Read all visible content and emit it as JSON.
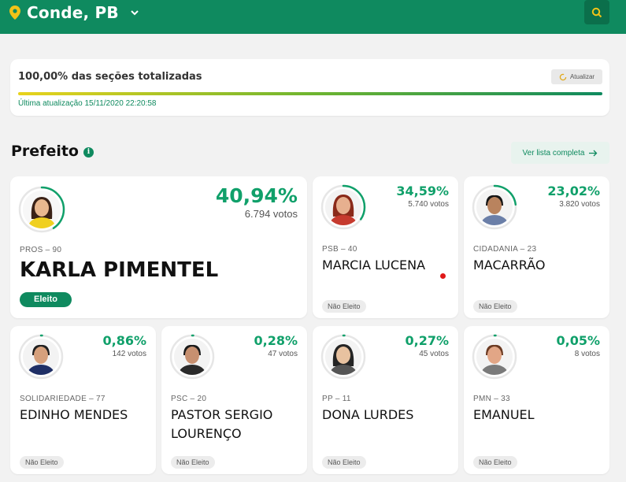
{
  "header": {
    "location": "Conde, PB"
  },
  "status": {
    "text": "100,00% das seções totalizadas",
    "progress_pct": 100,
    "last_update": "Última atualização 15/11/2020 22:20:58",
    "refresh_label": "Atualizar"
  },
  "section": {
    "title": "Prefeito",
    "full_list_label": "Ver lista completa"
  },
  "candidates": [
    {
      "party": "PROS – 90",
      "name": "KARLA PIMENTEL",
      "pct": "40,94%",
      "votes": "6.794 votos",
      "share": 40.94,
      "status": "Eleito"
    },
    {
      "party": "PSB – 40",
      "name": "MARCIA LUCENA",
      "pct": "34,59%",
      "votes": "5.740 votos",
      "share": 34.59,
      "status": "Não Eleito"
    },
    {
      "party": "CIDADANIA – 23",
      "name": "MACARRÃO",
      "pct": "23,02%",
      "votes": "3.820 votos",
      "share": 23.02,
      "status": "Não Eleito"
    },
    {
      "party": "SOLIDARIEDADE – 77",
      "name": "EDINHO MENDES",
      "pct": "0,86%",
      "votes": "142 votos",
      "share": 0.86,
      "status": "Não Eleito"
    },
    {
      "party": "PSC – 20",
      "name": "PASTOR SERGIO LOURENÇO",
      "pct": "0,28%",
      "votes": "47 votos",
      "share": 0.28,
      "status": "Não Eleito"
    },
    {
      "party": "PP – 11",
      "name": "DONA LURDES",
      "pct": "0,27%",
      "votes": "45 votos",
      "share": 0.27,
      "status": "Não Eleito"
    },
    {
      "party": "PMN – 33",
      "name": "EMANUEL",
      "pct": "0,05%",
      "votes": "8 votos",
      "share": 0.05,
      "status": "Não Eleito"
    }
  ],
  "colors": {
    "brand_green": "#0f8a5f",
    "pct_green": "#10a06a",
    "ring_track": "#e6e6e6"
  }
}
